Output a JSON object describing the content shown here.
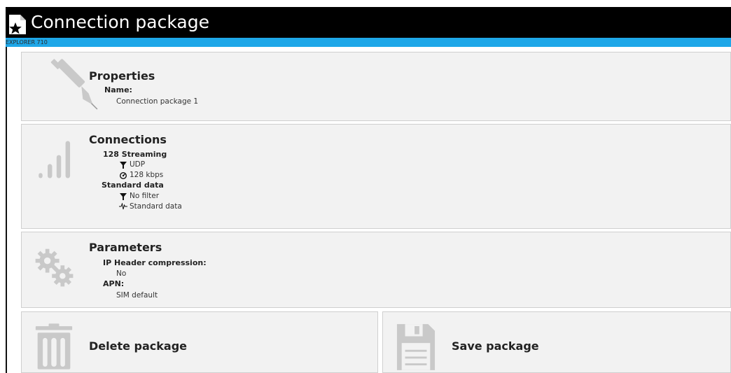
{
  "window": {
    "title": "Connection package",
    "device": "EXPLORER 710"
  },
  "properties": {
    "heading": "Properties",
    "name_label": "Name:",
    "name_value": "Connection package 1"
  },
  "connections": {
    "heading": "Connections",
    "items": [
      {
        "name": "128 Streaming",
        "filter": "UDP",
        "rate": "128 kbps"
      },
      {
        "name": "Standard data",
        "filter": "No filter",
        "rate": "Standard data"
      }
    ]
  },
  "parameters": {
    "heading": "Parameters",
    "ip_header_label": "IP Header compression:",
    "ip_header_value": "No",
    "apn_label": "APN:",
    "apn_value": "SIM default"
  },
  "actions": {
    "delete_label": "Delete package",
    "save_label": "Save package"
  },
  "icons": {
    "title": "package-star-icon",
    "properties": "pen-icon",
    "connections": "signal-bars-icon",
    "parameters": "gears-icon",
    "filter": "funnel-icon",
    "gauge": "gauge-icon",
    "standard": "standard-data-icon",
    "delete": "trash-icon",
    "save": "floppy-disk-icon"
  },
  "colors": {
    "titlebar": "#000000",
    "accent_bar": "#1ea7e8",
    "panel_bg": "#f2f2f2",
    "icon_gray": "#c9c9c9"
  }
}
